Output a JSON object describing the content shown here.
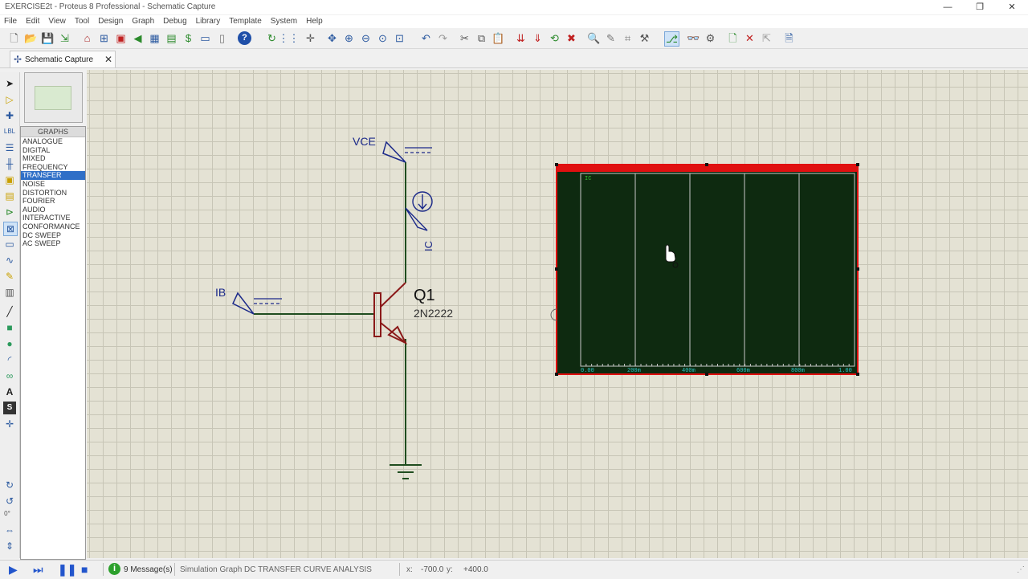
{
  "window": {
    "title": "EXERCISE2t - Proteus 8 Professional - Schematic Capture",
    "minimize": "—",
    "restore": "❐",
    "close": "✕"
  },
  "menu": [
    "File",
    "Edit",
    "View",
    "Tool",
    "Design",
    "Graph",
    "Debug",
    "Library",
    "Template",
    "System",
    "Help"
  ],
  "toolbar_icons": [
    "new-icon",
    "open-icon",
    "save-icon",
    "import-icon",
    "home-icon",
    "netlist-icon",
    "bom-icon",
    "back-icon",
    "gallery-icon",
    "pcb-icon",
    "source-icon",
    "code-icon",
    "doc-icon",
    "help-icon",
    "refresh-icon",
    "grid-icon",
    "origin-icon",
    "pan-icon",
    "zoom-in-icon",
    "zoom-out-icon",
    "zoom-all-icon",
    "zoom-area-icon",
    "undo-icon",
    "redo-icon",
    "cut-icon",
    "copy-icon",
    "paste-icon",
    "block-copy-icon",
    "block-move-icon",
    "block-rotate-icon",
    "block-delete-icon",
    "pick-device-icon",
    "make-device-icon",
    "package-icon",
    "decompose-icon",
    "wire-autorouter-icon",
    "search-icon",
    "property-icon",
    "new-sheet-icon",
    "remove-sheet-icon",
    "exit-to-parent-icon",
    "bill-icon"
  ],
  "tab": {
    "label": "Schematic Capture",
    "close": "✕"
  },
  "graphs": {
    "title": "GRAPHS",
    "items": [
      "ANALOGUE",
      "DIGITAL",
      "MIXED",
      "FREQUENCY",
      "TRANSFER",
      "NOISE",
      "DISTORTION",
      "FOURIER",
      "AUDIO",
      "INTERACTIVE",
      "CONFORMANCE",
      "DC SWEEP",
      "AC SWEEP"
    ],
    "selected": "TRANSFER"
  },
  "schematic": {
    "generators": {
      "vce": "VCE",
      "ib": "IB"
    },
    "probe": "IC",
    "transistor": {
      "ref": "Q1",
      "part": "2N2222"
    },
    "graph": {
      "trace_label": "IC",
      "x_ticks": [
        "0.00",
        "200m",
        "400m",
        "600m",
        "800m",
        "1.00"
      ]
    }
  },
  "left_tools": [
    "select-icon",
    "component-icon",
    "junction-icon",
    "wire-label-icon",
    "text-script-icon",
    "bus-icon",
    "subcircuit-icon",
    "terminal-icon",
    "pin-icon",
    "graph-icon",
    "tape-icon",
    "generator-icon",
    "probe-icon",
    "instrument-icon",
    "line-icon",
    "box-icon",
    "circle-icon",
    "arc-icon",
    "path-icon",
    "text-icon",
    "symbol-icon",
    "marker-icon",
    "rotate-cw-icon",
    "rotate-ccw-icon",
    "mirror-x-icon",
    "mirror-y-icon"
  ],
  "rotation_value": "0°",
  "status": {
    "messages": "9 Message(s)",
    "info": "Simulation Graph  DC TRANSFER CURVE ANALYSIS",
    "x_coord": "-700.0",
    "y_coord": "+400.0"
  },
  "colors": {
    "graph_bg": "#0e2a10",
    "graph_border": "#e01010",
    "wire": "#1f4d1f",
    "component": "#8b1a1a",
    "label": "#1c2a8a",
    "selection": "#2f6fc7"
  }
}
